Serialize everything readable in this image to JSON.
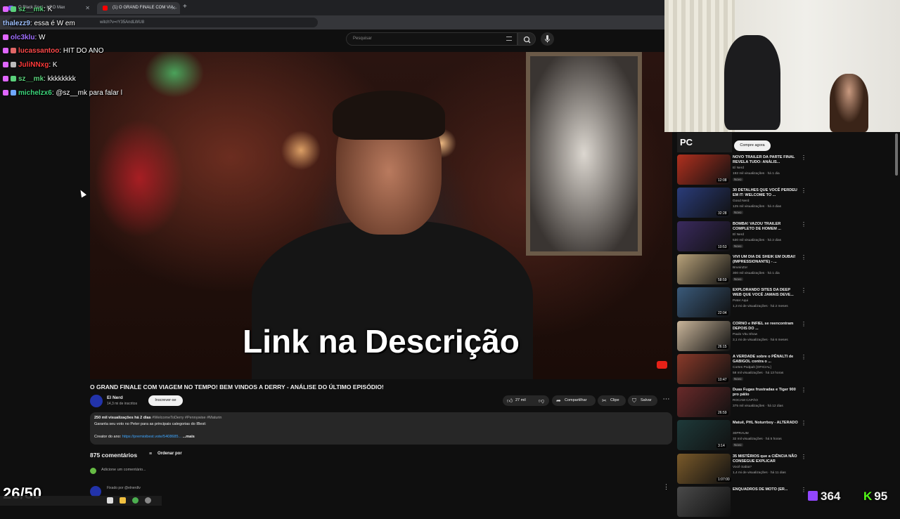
{
  "browser": {
    "tabs": [
      {
        "label": "O Black Spot - HBO Max",
        "favicon_color": "#7b4dff"
      },
      {
        "label": "(1) O GRAND FINALE COM VIA...",
        "favicon_color": "#ff0000"
      }
    ],
    "new_tab": "+",
    "url": "witch?v=rY35AndLWU8"
  },
  "header": {
    "search_placeholder": "Pesquisar"
  },
  "video": {
    "caption": "Link na Descrição",
    "title": "O GRAND FINALE COM VIAGEM NO TEMPO! BEM VINDOS A DERRY - ANÁLISE DO ÚLTIMO EPISÓDIO!",
    "channel_name": "El Nerd",
    "channel_subs": "14,3 mi de inscritos",
    "subscribe_label": "Inscrever-se",
    "likes": "27 mil",
    "share_label": "Compartilhar",
    "clip_label": "Clipe",
    "save_label": "Salvar",
    "more_icon": "⋯",
    "description": {
      "stats": "250 mil visualizações  há 2 dias",
      "tags": "#WelcomeToDerry #Pennywise #Maturin",
      "line2": "Garanta seu voto no Peter para as principais categorias do IBest:",
      "line3_prefix": "Creator do ano: ",
      "line3_link": "https://premioibest.vote/5408685...",
      "line3_more": " ...mais"
    }
  },
  "comments": {
    "count": "875 comentários",
    "sort_label": "Ordenar por",
    "add_placeholder": "Adicione um comentário...",
    "pinned_label": "Fixado por @elnerdtv"
  },
  "chat": [
    {
      "user": "sz__mk",
      "message": ": K",
      "color": "#5ad17b"
    },
    {
      "user": "thalezz9",
      "message": ": essa é W em",
      "color": "#9fc1ff"
    },
    {
      "user": "olc3klu",
      "message": ": W",
      "color": "#a070ff"
    },
    {
      "user": "lucassantoo",
      "message": ": HIT DO ANO",
      "color": "#ff4b4b"
    },
    {
      "user": "JuliNNxg",
      "message": ": K",
      "color": "#ff3a3a"
    },
    {
      "user": "sz__mk",
      "message": ": kkkkkkkk",
      "color": "#5ad17b"
    },
    {
      "user": "michelzx6",
      "message": ": @sz__mk para falar l",
      "color": "#3cd67b"
    }
  ],
  "sidebar": {
    "promo_text": "PC",
    "promo_button": "Compre agora",
    "recommendations": [
      {
        "title": "NOVO TRAILER DA PARTE FINAL REVELA TUDO: ANÁLIS...",
        "channel": "El Nerd",
        "views": "192 mil visualizações · há 1 dia",
        "badge": "Novo",
        "duration": "12:08",
        "thumb_color": "#b0301e"
      },
      {
        "title": "30 DETALHES QUE VOCÊ PERDEU EM IT: WELCOME TO ...",
        "channel": "Good Nerd",
        "views": "125 mil visualizações · há 4 dias",
        "badge": "Novo",
        "duration": "32:28",
        "thumb_color": "#2a3c7a"
      },
      {
        "title": "BOMBA! VAZOU TRAILER COMPLETO DE HOMEM ...",
        "channel": "El Nerd",
        "views": "530 mil visualizações · há 2 dias",
        "badge": "Novo",
        "duration": "10:53",
        "thumb_color": "#3a2a5e"
      },
      {
        "title": "VIVI UM DIA DE SHEIK EM DUBAI! (IMPRESSIONANTE) - ...",
        "channel": "BruninZor",
        "views": "300 mil visualizações · há 1 dia",
        "badge": "Novo",
        "duration": "58:59",
        "thumb_color": "#b8a27a"
      },
      {
        "title": "EXPLORANDO SITES DA DEEP WEB QUE VOCÊ JAMAIS DEVE...",
        "channel": "Peter Aqui",
        "views": "1,3 mi de visualizações · há 2 meses",
        "badge": "",
        "duration": "22:04",
        "thumb_color": "#3a5a7a"
      },
      {
        "title": "CORNO e INFIEL se reencontram DEPOIS DO ...",
        "channel": "Paulo Vitu Show",
        "views": "3,1 mi de visualizações · há 6 meses",
        "badge": "",
        "duration": "26:15",
        "thumb_color": "#c9b59a"
      },
      {
        "title": "A VERDADE sobre o PÊNALTI de GABIGOL contra o ...",
        "channel": "Cortes Podpah [OFICIAL]",
        "views": "58 mil visualizações · há 13 horas",
        "badge": "Novo",
        "duration": "10:47",
        "thumb_color": "#8a3a2a"
      },
      {
        "title": "Duas Fugas frustradas e Tiger 900 pro pátio",
        "channel": "ROCAM CAPÃO",
        "views": "375 mil visualizações · há 12 dias",
        "badge": "",
        "duration": "26:59",
        "thumb_color": "#6a2a2a"
      },
      {
        "title": "Matuê, PHL Noturrboy - ALTERADO",
        "channel": "30PRAUM",
        "views": "32 mil visualizações · há 5 horas",
        "badge": "Novo",
        "duration": "3:14",
        "thumb_color": "#1e3a3a"
      },
      {
        "title": "35 MISTÉRIOS que a CIÊNCIA NÃO CONSEGUE EXPLICAR",
        "channel": "Você Sabia?",
        "views": "1,4 mi de visualizações · há 11 dias",
        "badge": "",
        "duration": "1:07:00",
        "thumb_color": "#7a5a2a"
      },
      {
        "title": "ENQUADROS DE MOTO (ER...",
        "channel": "",
        "views": "",
        "badge": "",
        "duration": "",
        "thumb_color": "#4a4a4a"
      }
    ]
  },
  "overlay": {
    "progress": "26/50",
    "viewers_twitch": "364",
    "viewers_kick": "95"
  }
}
